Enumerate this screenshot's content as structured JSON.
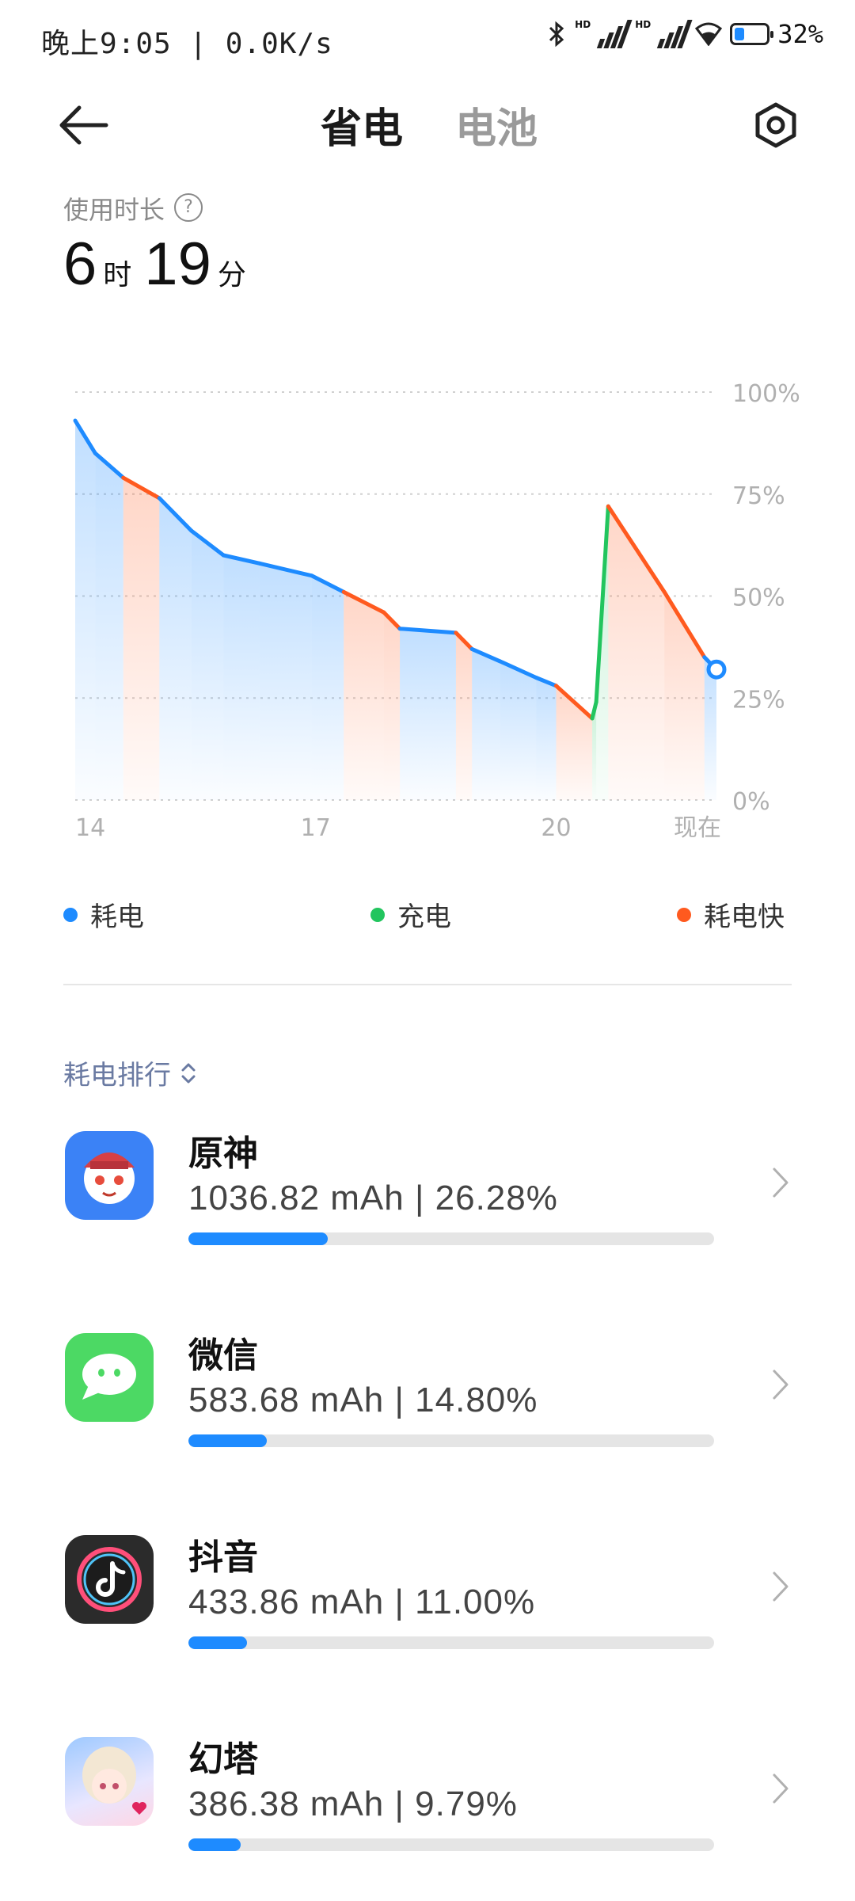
{
  "status_bar": {
    "time_speed": "晚上9:05 | 0.0K/s",
    "battery_level": 32,
    "battery_text": "32%",
    "hd1": "HD",
    "hd2": "HD",
    "icons": [
      "bluetooth-icon",
      "signal-1-icon",
      "signal-2-icon",
      "wifi-icon",
      "battery-icon"
    ]
  },
  "header": {
    "tabs": [
      {
        "label": "省电",
        "active": true
      },
      {
        "label": "电池",
        "active": false
      }
    ],
    "back_icon": "arrow-left-icon",
    "settings_icon": "settings-icon"
  },
  "usage": {
    "label": "使用时长",
    "hours": "6",
    "hours_unit": "时",
    "minutes": "19",
    "minutes_unit": "分"
  },
  "chart_data": {
    "type": "line",
    "x_tick_labels": [
      "14",
      "17",
      "20",
      "现在"
    ],
    "y_tick_labels": [
      "100%",
      "75%",
      "50%",
      "25%",
      "0%"
    ],
    "ylim": [
      0,
      100
    ],
    "grid": true,
    "series_colors": {
      "drain": "#1E8BFF",
      "charge": "#22C55E",
      "fast_drain": "#FF5A1F"
    },
    "points": [
      {
        "t": 14.0,
        "v": 93,
        "s": "fast"
      },
      {
        "t": 14.25,
        "v": 85,
        "s": "drain"
      },
      {
        "t": 14.6,
        "v": 79,
        "s": "drain"
      },
      {
        "t": 15.05,
        "v": 74,
        "s": "fast"
      },
      {
        "t": 15.45,
        "v": 66,
        "s": "drain"
      },
      {
        "t": 15.85,
        "v": 60,
        "s": "drain"
      },
      {
        "t": 16.3,
        "v": 58,
        "s": "drain"
      },
      {
        "t": 16.95,
        "v": 55,
        "s": "drain"
      },
      {
        "t": 17.35,
        "v": 51,
        "s": "drain"
      },
      {
        "t": 17.85,
        "v": 46,
        "s": "fast"
      },
      {
        "t": 18.05,
        "v": 42,
        "s": "fast"
      },
      {
        "t": 18.75,
        "v": 41,
        "s": "drain"
      },
      {
        "t": 18.95,
        "v": 37,
        "s": "fast"
      },
      {
        "t": 19.3,
        "v": 34,
        "s": "drain"
      },
      {
        "t": 19.75,
        "v": 30,
        "s": "drain"
      },
      {
        "t": 20.0,
        "v": 28,
        "s": "drain"
      },
      {
        "t": 20.45,
        "v": 20,
        "s": "fast"
      },
      {
        "t": 20.5,
        "v": 24,
        "s": "charge"
      },
      {
        "t": 20.65,
        "v": 72,
        "s": "charge"
      },
      {
        "t": 21.35,
        "v": 51,
        "s": "fast"
      },
      {
        "t": 21.85,
        "v": 35,
        "s": "fast"
      },
      {
        "t": 22.0,
        "v": 32,
        "s": "drain"
      }
    ]
  },
  "legend": [
    {
      "label": "耗电",
      "color": "#1E8BFF"
    },
    {
      "label": "充电",
      "color": "#22C55E"
    },
    {
      "label": "耗电快",
      "color": "#FF5A1F"
    }
  ],
  "ranking": {
    "title": "耗电排行",
    "sort_icon": "sort-updown-icon",
    "apps": [
      {
        "name": "原神",
        "usage": "1036.82 mAh | 26.28%",
        "percent": 26.28,
        "icon": "genshin-icon"
      },
      {
        "name": "微信",
        "usage": "583.68 mAh | 14.80%",
        "percent": 14.8,
        "icon": "wechat-icon"
      },
      {
        "name": "抖音",
        "usage": "433.86 mAh | 11.00%",
        "percent": 11.0,
        "icon": "douyin-icon"
      },
      {
        "name": "幻塔",
        "usage": "386.38 mAh | 9.79%",
        "percent": 9.79,
        "icon": "tower-of-fantasy-icon"
      }
    ]
  }
}
